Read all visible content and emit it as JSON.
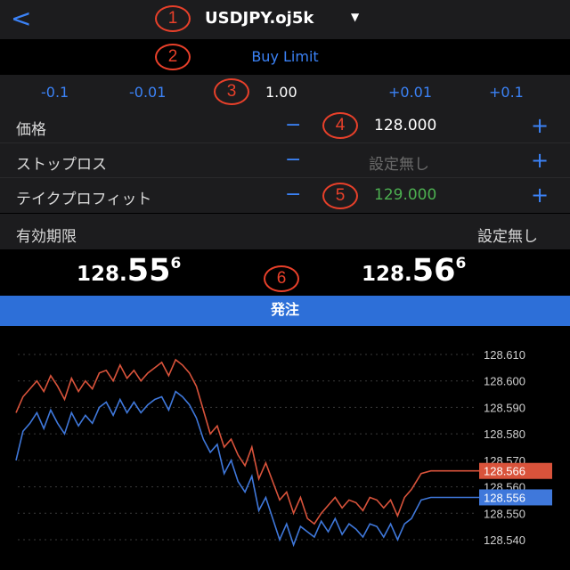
{
  "header": {
    "back_icon": "chevron-left-icon",
    "symbol": "USDJPY.oj5k",
    "caret_icon": "caret-down-icon"
  },
  "annotations": [
    "1",
    "2",
    "3",
    "4",
    "5",
    "6"
  ],
  "order_type": "Buy Limit",
  "steps": {
    "minus_large": "-0.1",
    "minus_small": "-0.01",
    "current": "1.00",
    "plus_small": "+0.01",
    "plus_large": "+0.1"
  },
  "rows": {
    "price": {
      "label": "価格",
      "minus": "−",
      "value": "128.000",
      "plus": "+"
    },
    "stop_loss": {
      "label": "ストップロス",
      "minus": "−",
      "value": "設定無し",
      "plus": "+"
    },
    "take_profit": {
      "label": "テイクプロフィット",
      "minus": "−",
      "value": "129.000",
      "plus": "+"
    }
  },
  "expiry": {
    "label": "有効期限",
    "value": "設定無し"
  },
  "quotes": {
    "bid": {
      "prefix": "128.",
      "big": "55",
      "sup": "6"
    },
    "ask": {
      "prefix": "128.",
      "big": "56",
      "sup": "6"
    }
  },
  "order_button": "発注",
  "colors": {
    "accent": "#3b82f6",
    "ask_line": "#d9533b",
    "bid_line": "#3f78db",
    "take_profit": "#4caf50",
    "badge": "#e8402a"
  },
  "chart_data": {
    "type": "line",
    "ylim": [
      128.535,
      128.615
    ],
    "y_ticks": [
      "128.610",
      "128.600",
      "128.590",
      "128.580",
      "128.570",
      "128.560",
      "128.550",
      "128.540"
    ],
    "tick_values": [
      128.61,
      128.6,
      128.59,
      128.58,
      128.57,
      128.56,
      128.55,
      128.54
    ],
    "last_labels": {
      "ask": "128.566",
      "bid": "128.556"
    },
    "series": [
      {
        "key": "ask",
        "values": [
          128.588,
          128.594,
          128.597,
          128.6,
          128.596,
          128.602,
          128.598,
          128.593,
          128.601,
          128.596,
          128.6,
          128.597,
          128.603,
          128.604,
          128.6,
          128.606,
          128.601,
          128.604,
          128.6,
          128.603,
          128.605,
          128.607,
          128.602,
          128.608,
          128.606,
          128.603,
          128.598,
          128.589,
          128.58,
          128.583,
          128.575,
          128.578,
          128.572,
          128.568,
          128.575,
          128.563,
          128.569,
          128.562,
          128.555,
          128.558,
          128.55,
          128.556,
          128.548,
          128.546,
          128.55,
          128.553,
          128.556,
          128.552,
          128.555,
          128.554,
          128.551,
          128.556,
          128.555,
          128.552,
          128.555,
          128.549,
          128.556,
          128.559,
          128.565,
          128.566,
          128.566,
          128.566,
          128.566,
          128.566,
          128.566
        ]
      },
      {
        "key": "bid",
        "values": [
          128.57,
          128.581,
          128.584,
          128.588,
          128.582,
          128.589,
          128.584,
          128.58,
          128.588,
          128.583,
          128.587,
          128.584,
          128.59,
          128.592,
          128.587,
          128.593,
          128.588,
          128.592,
          128.588,
          128.591,
          128.593,
          128.594,
          128.589,
          128.596,
          128.594,
          128.591,
          128.586,
          128.578,
          128.573,
          128.576,
          128.565,
          128.57,
          128.562,
          128.558,
          128.564,
          128.551,
          128.556,
          128.548,
          128.54,
          128.546,
          128.538,
          128.545,
          128.543,
          128.541,
          128.547,
          128.543,
          128.548,
          128.542,
          128.546,
          128.544,
          128.541,
          128.546,
          128.545,
          128.541,
          128.546,
          128.54,
          128.546,
          128.548,
          128.555,
          128.556,
          128.556,
          128.556,
          128.556,
          128.556,
          128.556
        ]
      }
    ]
  }
}
